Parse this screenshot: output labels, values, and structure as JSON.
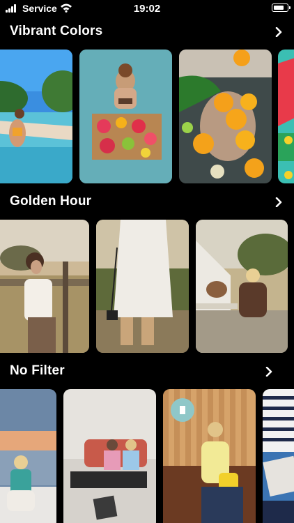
{
  "status_bar": {
    "carrier": "Service",
    "time": "19:02",
    "battery_level": 0.85
  },
  "sections": [
    {
      "title": "Vibrant Colors",
      "photos": [
        "pool-swimsuit-photo",
        "pool-floating-tray-photo",
        "citrus-bath-photo",
        "watermelon-photo"
      ]
    },
    {
      "title": "Golden Hour",
      "photos": [
        "field-fence-portrait-photo",
        "white-dress-camera-photo",
        "goat-fence-photo"
      ]
    },
    {
      "title": "No Filter",
      "photos": [
        "sunset-boat-photo",
        "bedroom-friends-photo",
        "cafe-bench-photo",
        "striped-shirt-photo"
      ]
    }
  ],
  "icons": {
    "signal": "signal-bars-icon",
    "wifi": "wifi-icon",
    "battery": "battery-icon",
    "chevron": "chevron-right-icon"
  }
}
